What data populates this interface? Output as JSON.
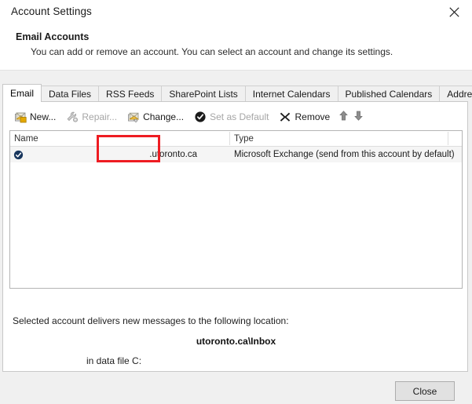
{
  "window": {
    "title": "Account Settings",
    "close_icon": "close-x-icon"
  },
  "header": {
    "title": "Email Accounts",
    "description": "You can add or remove an account. You can select an account and change its settings."
  },
  "tabs": [
    {
      "label": "Email",
      "active": true
    },
    {
      "label": "Data Files",
      "active": false
    },
    {
      "label": "RSS Feeds",
      "active": false
    },
    {
      "label": "SharePoint Lists",
      "active": false
    },
    {
      "label": "Internet Calendars",
      "active": false
    },
    {
      "label": "Published Calendars",
      "active": false
    },
    {
      "label": "Address Books",
      "active": false
    }
  ],
  "toolbar": {
    "items": [
      {
        "label": "New...",
        "icon": "new-account-icon",
        "enabled": true,
        "highlighted": false
      },
      {
        "label": "Repair...",
        "icon": "repair-icon",
        "enabled": false,
        "highlighted": false
      },
      {
        "label": "Change...",
        "icon": "change-account-icon",
        "enabled": true,
        "highlighted": true
      },
      {
        "label": "Set as Default",
        "icon": "check-circle-icon",
        "enabled": false,
        "highlighted": false
      },
      {
        "label": "Remove",
        "icon": "remove-x-icon",
        "enabled": true,
        "highlighted": false
      }
    ],
    "move_up_icon": "arrow-up-icon",
    "move_down_icon": "arrow-down-icon"
  },
  "highlight": {
    "target": "Change...",
    "color": "#ee1c22"
  },
  "account_list": {
    "columns": [
      "Name",
      "Type"
    ],
    "rows": [
      {
        "selected": true,
        "default_icon": "default-account-check-icon",
        "name": ".utoronto.ca",
        "type": "Microsoft Exchange (send from this account by default)"
      }
    ]
  },
  "delivery_info": {
    "line": "Selected account delivers new messages to the following location:",
    "location": "utoronto.ca\\Inbox",
    "data_file": "in data file C:"
  },
  "footer": {
    "close_button": "Close"
  }
}
